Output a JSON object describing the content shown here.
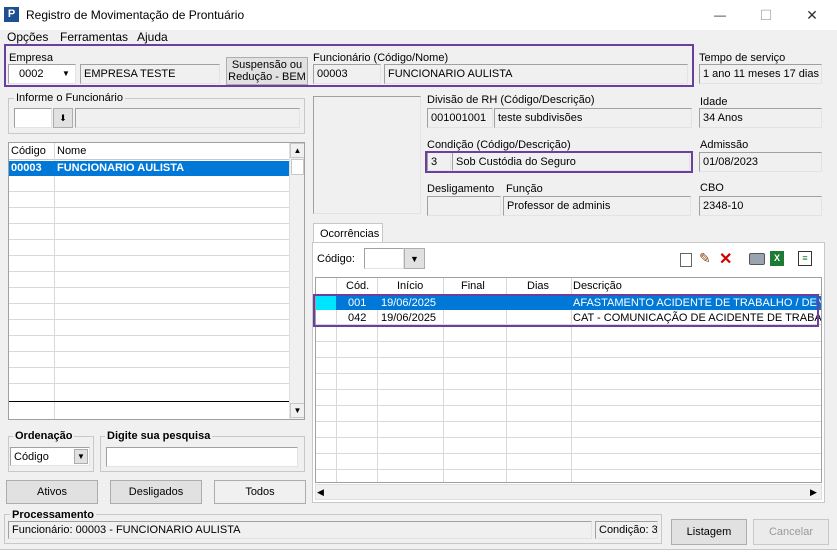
{
  "window": {
    "title": "Registro de Movimentação de Prontuário",
    "minimize": "—",
    "maximize": "☐",
    "close": "✕"
  },
  "menu": [
    "Opções",
    "Ferramentas",
    "Ajuda"
  ],
  "empresa": {
    "label": "Empresa",
    "code": "0002",
    "name": "EMPRESA TESTE"
  },
  "suspensao_button": "Suspensão ou Redução - BEM",
  "funcionario": {
    "label": "Funcionário (Código/Nome)",
    "code": "00003",
    "name": "FUNCIONARIO  AULISTA"
  },
  "tempo_servico": {
    "label": "Tempo de serviço",
    "value": "1 ano 11 meses 17 dias"
  },
  "informe": {
    "label": "Informe o Funcionário"
  },
  "employee_list": {
    "headers": [
      "Código",
      "Nome"
    ],
    "rows": [
      {
        "code": "00003",
        "name": "FUNCIONARIO  AULISTA"
      }
    ]
  },
  "divisao": {
    "label": "Divisão de RH (Código/Descrição)",
    "code": "001001001",
    "desc": "teste subdivisões"
  },
  "idade": {
    "label": "Idade",
    "value": "34 Anos"
  },
  "condicao": {
    "label": "Condição (Código/Descrição)",
    "code": "3",
    "desc": "Sob Custódia do Seguro"
  },
  "admissao": {
    "label": "Admissão",
    "value": "01/08/2023"
  },
  "desligamento": {
    "label": "Desligamento",
    "value": ""
  },
  "funcao": {
    "label": "Função",
    "value": "Professor de adminis"
  },
  "cbo": {
    "label": "CBO",
    "value": "2348-10"
  },
  "ocorrencias": {
    "tab": "Ocorrências",
    "codigo_label": "Código:",
    "headers": [
      "Cód.",
      "Início",
      "Final",
      "Dias",
      "Descrição"
    ],
    "rows": [
      {
        "cod": "001",
        "inicio": "19/06/2025",
        "final": "",
        "dias": "",
        "desc": "AFASTAMENTO ACIDENTE DE TRABALHO / DENTRO"
      },
      {
        "cod": "042",
        "inicio": "19/06/2025",
        "final": "",
        "dias": "",
        "desc": "CAT - COMUNICAÇÃO DE ACIDENTE DE TRABALHO"
      }
    ]
  },
  "ordenacao": {
    "label": "Ordenação",
    "value": "Código"
  },
  "pesquisa": {
    "label": "Digite sua pesquisa",
    "value": ""
  },
  "filter_buttons": [
    "Ativos",
    "Desligados",
    "Todos"
  ],
  "processamento": {
    "label": "Processamento",
    "text": "Funcionário: 00003 - FUNCIONARIO  AULISTA",
    "condicao": "Condição: 3"
  },
  "listagem_button": "Listagem",
  "cancelar_button": "Cancelar",
  "colors": {
    "selection": "#0078d7",
    "highlight_border": "#6a3fa0",
    "cyan_indicator": "#00e5ff"
  }
}
